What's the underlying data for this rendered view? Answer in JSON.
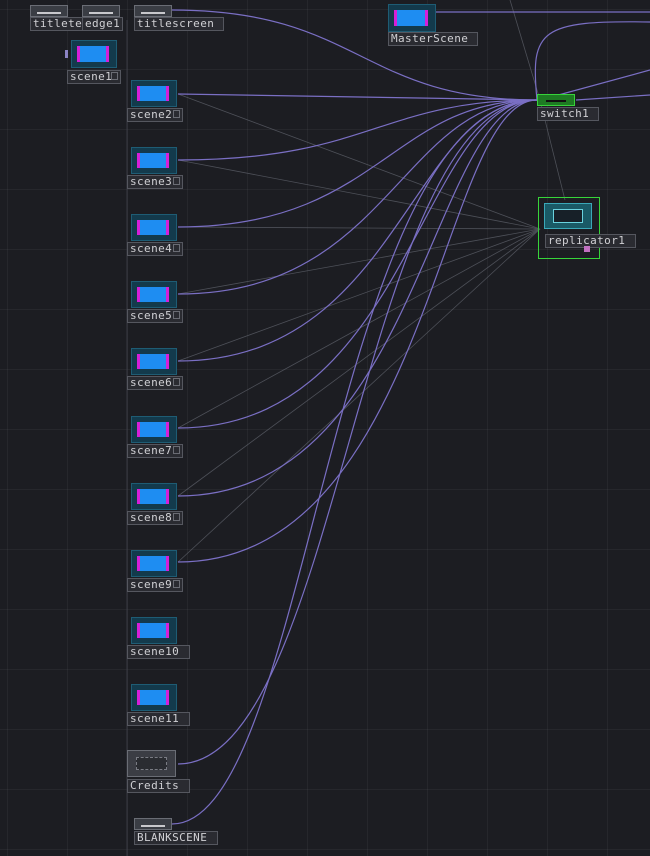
{
  "app": "network-editor",
  "colors": {
    "background": "#1c1d22",
    "wire": "#7a6fc4",
    "wire_faint": "#5a5d66",
    "selected": "#37d43a",
    "top_fill": "#1e8df2",
    "top_edge": "#d51fd8"
  },
  "nodes": {
    "titleteaser": "titleteaser",
    "edge1": "edge1",
    "titlescreen": "titlescreen",
    "masterscene": "MasterScene",
    "scene1": "scene1",
    "scene2": "scene2",
    "scene3": "scene3",
    "scene4": "scene4",
    "scene5": "scene5",
    "scene6": "scene6",
    "scene7": "scene7",
    "scene8": "scene8",
    "scene9": "scene9",
    "scene10": "scene10",
    "scene11": "scene11",
    "credits": "Credits",
    "blankscene": "BLANKSCENE",
    "switch1": "switch1",
    "replicator1": "replicator1"
  }
}
